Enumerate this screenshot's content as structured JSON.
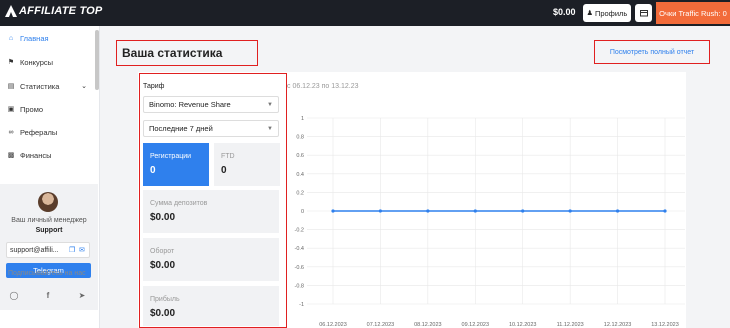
{
  "header": {
    "logo_text": "AFFILIATE TOP",
    "balance": "$0.00",
    "profile_label": "Профиль",
    "traffic_rush_label": "Очки Traffic Rush: 0"
  },
  "sidebar": {
    "items": [
      {
        "label": "Главная",
        "icon": "home-icon",
        "active": true
      },
      {
        "label": "Конкурсы",
        "icon": "trophy-icon"
      },
      {
        "label": "Статистика",
        "icon": "chart-icon",
        "chevron": true
      },
      {
        "label": "Промо",
        "icon": "image-icon"
      },
      {
        "label": "Рефералы",
        "icon": "link-icon"
      },
      {
        "label": "Финансы",
        "icon": "wallet-icon"
      }
    ],
    "manager": {
      "title": "Ваш личный менеджер",
      "name": "Support",
      "email": "support@affili...",
      "telegram_label": "Telegram"
    },
    "subscribe_label": "Подписывайтесь на нас",
    "social_icons": [
      "instagram-icon",
      "facebook-icon",
      "telegram-icon"
    ]
  },
  "main": {
    "title": "Ваша статистика",
    "full_report_link": "Посмотреть полный отчет",
    "tariff_label": "Тариф",
    "tariff_select": "Binomo: Revenue Share",
    "period_select": "Последние 7 дней",
    "date_range": "с 06.12.23 по 13.12.23",
    "stats": {
      "registrations_label": "Регистрации",
      "registrations_value": "0",
      "ftd_label": "FTD",
      "ftd_value": "0",
      "deposits_label": "Сумма депозитов",
      "deposits_value": "$0.00",
      "turnover_label": "Оборот",
      "turnover_value": "$0.00",
      "profit_label": "Прибыль",
      "profit_value": "$0.00"
    }
  },
  "chart_data": {
    "type": "line",
    "x": [
      "06.12.2023",
      "07.12.2023",
      "08.12.2023",
      "09.12.2023",
      "10.12.2023",
      "11.12.2023",
      "12.12.2023",
      "13.12.2023"
    ],
    "series": [
      {
        "values": [
          0,
          0,
          0,
          0,
          0,
          0,
          0,
          0
        ]
      }
    ],
    "yticks": [
      "1",
      "0.8",
      "0.6",
      "0.4",
      "0.2",
      "0",
      "-0.2",
      "-0.4",
      "-0.6",
      "-0.8",
      "-1"
    ],
    "ylim": [
      -1,
      1
    ],
    "grid": true,
    "colors": {
      "line": "#2f80ed",
      "grid": "#e8e8e8"
    }
  }
}
